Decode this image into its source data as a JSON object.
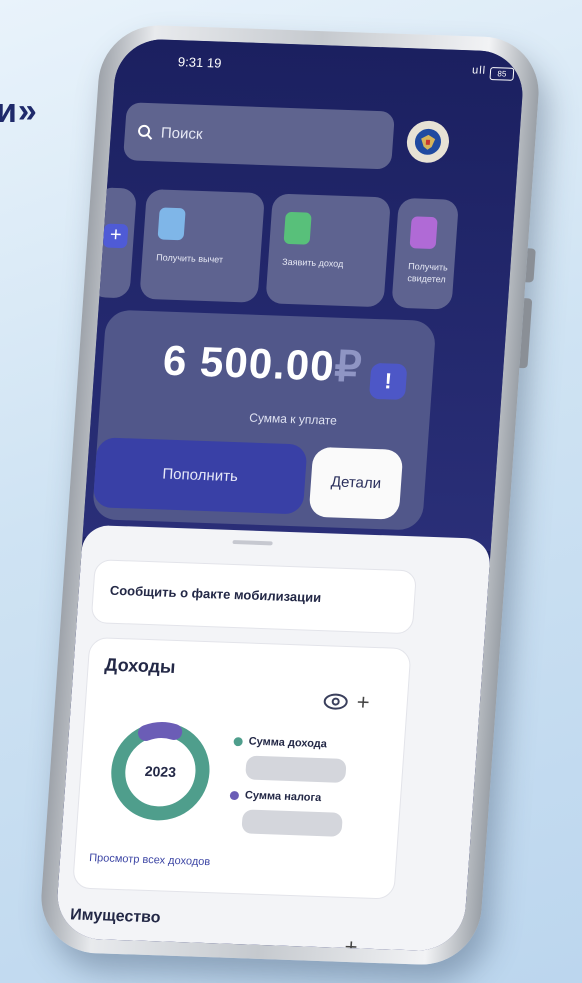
{
  "background": {
    "heading_fragment": "и»"
  },
  "status_bar": {
    "time": "9:31",
    "time_suffix": "19",
    "signal": "ull",
    "battery": "85"
  },
  "search": {
    "placeholder": "Поиск"
  },
  "quick_actions": [
    {
      "label": "Получить вычет",
      "color": "#7fb6e8"
    },
    {
      "label": "Заявить доход",
      "color": "#58c07a"
    },
    {
      "label": "Получить свидетел",
      "color": "#b06ad6"
    }
  ],
  "balance": {
    "amount": "6 500.00",
    "currency": "₽",
    "caption": "Сумма к уплате",
    "alert": "!"
  },
  "actions": {
    "pay": "Пополнить",
    "details": "Детали"
  },
  "mobilization": {
    "label": "Сообщить о факте мобилизации"
  },
  "income": {
    "title": "Доходы",
    "year": "2023",
    "legend": [
      {
        "label": "Сумма дохода",
        "color": "#4f9e8c"
      },
      {
        "label": "Сумма налога",
        "color": "#6b5db6"
      }
    ],
    "view_all": "Просмотр всех доходов"
  },
  "property": {
    "title": "Имущество"
  },
  "colors": {
    "accent": "#3940a6",
    "dark_bg": "#1e2466"
  }
}
